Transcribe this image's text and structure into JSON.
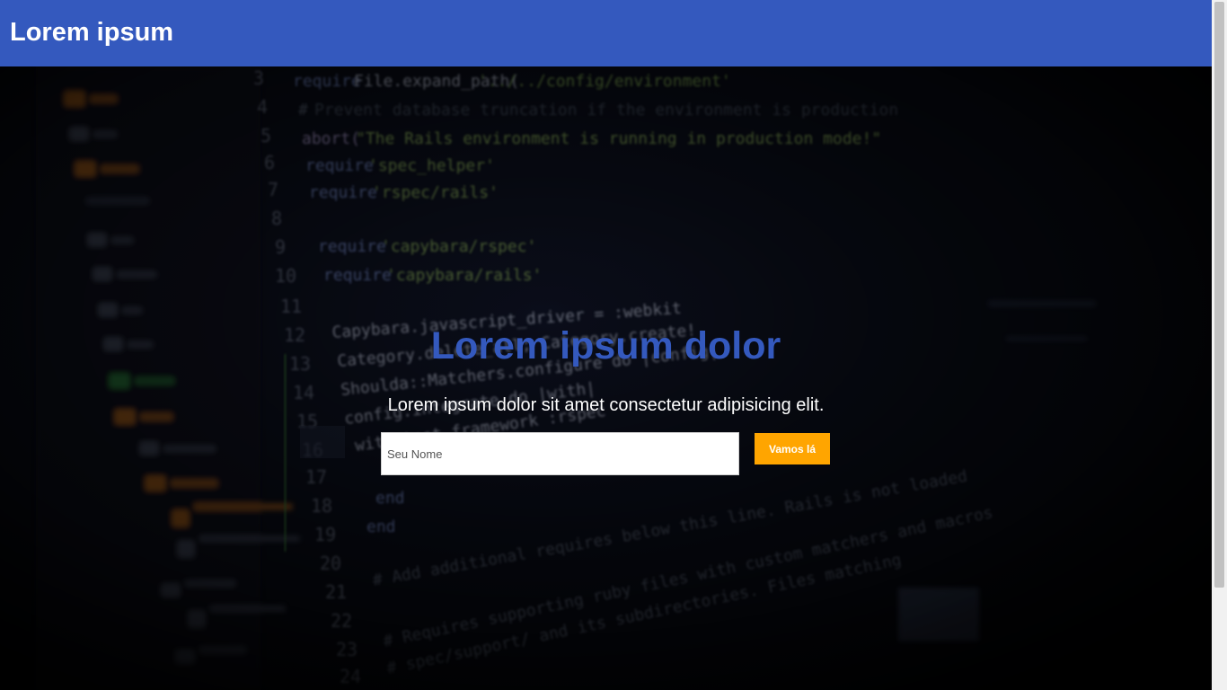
{
  "header": {
    "brand": "Lorem ipsum",
    "background_color": "#3459be"
  },
  "hero": {
    "title": "Lorem ipsum dolor",
    "title_color": "#3459be",
    "subtitle": "Lorem ipsum dolor sit amet consectetur adipisicing elit.",
    "name_input": {
      "value": "",
      "placeholder": "Seu Nome"
    },
    "submit_label": "Vamos lá",
    "submit_color": "#ffa500",
    "background_image": "blurred-code-editor-photo"
  }
}
